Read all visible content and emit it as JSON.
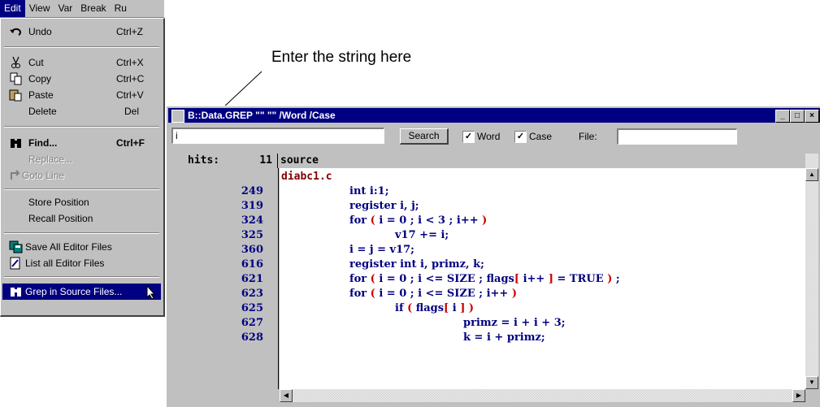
{
  "menubar": {
    "items": [
      "Edit",
      "View",
      "Var",
      "Break",
      "Ru"
    ]
  },
  "edit_menu": {
    "items": [
      {
        "label": "Undo",
        "accel": "Ctrl+Z",
        "icon": "undo-icon"
      },
      {
        "label": "Cut",
        "accel": "Ctrl+X",
        "icon": "scissors-icon"
      },
      {
        "label": "Copy",
        "accel": "Ctrl+C",
        "icon": "copy-icon"
      },
      {
        "label": "Paste",
        "accel": "Ctrl+V",
        "icon": "paste-icon"
      },
      {
        "label": "Delete",
        "accel": "Del"
      },
      {
        "label": "Find...",
        "accel": "Ctrl+F",
        "icon": "binoculars-icon"
      },
      {
        "label": "Replace...",
        "accel": ""
      },
      {
        "label": "Goto Line",
        "accel": "",
        "icon": "goto-line-icon"
      },
      {
        "label": "Store Position",
        "accel": ""
      },
      {
        "label": "Recall Position",
        "accel": ""
      },
      {
        "label": "Save All Editor Files",
        "accel": "",
        "icon": "save-all-icon"
      },
      {
        "label": "List all Editor Files",
        "accel": "",
        "icon": "list-files-icon"
      },
      {
        "label": "Grep in Source Files...",
        "accel": "",
        "icon": "binoculars-icon"
      }
    ]
  },
  "annotation": {
    "text": "Enter the string here"
  },
  "window": {
    "title": "B::Data.GREP \"\" \"\" /Word /Case",
    "controls": {
      "minimize": "_",
      "maximize": "□",
      "close": "×"
    }
  },
  "toolbar": {
    "search_value": "i",
    "search_button": "Search",
    "word_label": "Word",
    "case_label": "Case",
    "file_label": "File:",
    "word_checked": true,
    "case_checked": true
  },
  "results": {
    "hits_label": "hits:",
    "hits_count": "11",
    "source_label": "source",
    "file": "diabc1.c",
    "lines": [
      {
        "num": "249",
        "code": "int i:1;"
      },
      {
        "num": "319",
        "code": "register i, j;"
      },
      {
        "num": "324",
        "code_parts": [
          "for ",
          "(",
          " i = 0 ; i < 3 ; i++ ",
          ")"
        ]
      },
      {
        "num": "325",
        "code": "v17 += i;"
      },
      {
        "num": "360",
        "code": "i = j = v17;"
      },
      {
        "num": "616",
        "code": "register int i, primz, k;"
      },
      {
        "num": "621",
        "code_parts": [
          "for ",
          "(",
          " i = 0 ; i <= SIZE ; flags",
          "[",
          " i++ ",
          "]",
          " = TRUE ",
          ")",
          " ;"
        ]
      },
      {
        "num": "623",
        "code_parts": [
          "for ",
          "(",
          " i = 0 ; i <= SIZE ; i++ ",
          ")"
        ]
      },
      {
        "num": "625",
        "code_parts": [
          "if ",
          "(",
          " flags",
          "[",
          " i ",
          "]",
          " ",
          ")"
        ]
      },
      {
        "num": "627",
        "code": "primz = i + i + 3;"
      },
      {
        "num": "628",
        "code": "k = i + primz;"
      }
    ]
  }
}
